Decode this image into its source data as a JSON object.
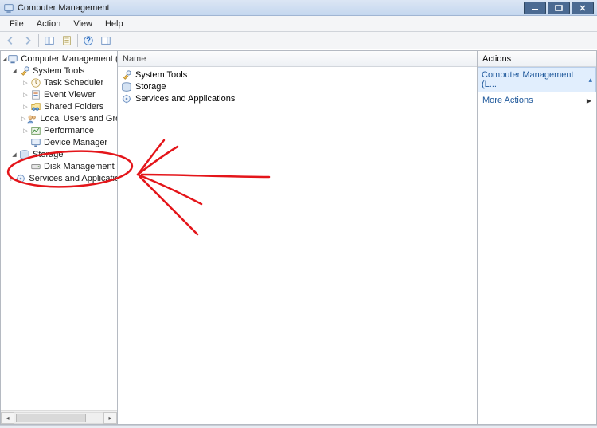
{
  "window": {
    "title": "Computer Management"
  },
  "menu": {
    "file": "File",
    "action": "Action",
    "view": "View",
    "help": "Help"
  },
  "tree": {
    "root": "Computer Management (Local)",
    "system_tools": "System Tools",
    "task_scheduler": "Task Scheduler",
    "event_viewer": "Event Viewer",
    "shared_folders": "Shared Folders",
    "local_users": "Local Users and Groups",
    "performance": "Performance",
    "device_manager": "Device Manager",
    "storage": "Storage",
    "disk_management": "Disk Management",
    "services_apps": "Services and Applications"
  },
  "list": {
    "header_name": "Name",
    "items": {
      "0": "System Tools",
      "1": "Storage",
      "2": "Services and Applications"
    }
  },
  "actions": {
    "header": "Actions",
    "section": "Computer Management (L...",
    "more": "More Actions"
  }
}
